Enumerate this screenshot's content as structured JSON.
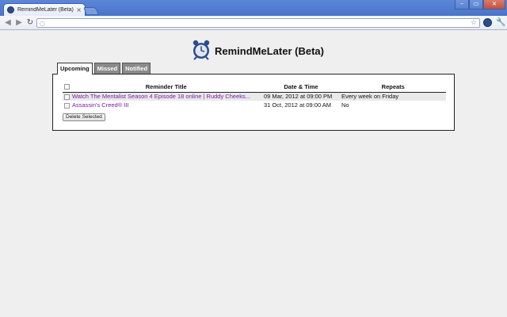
{
  "browser": {
    "tab_title": "RemindMeLater (Beta) - Up",
    "tab_close": "×",
    "window_buttons": [
      "–",
      "▭",
      "×"
    ]
  },
  "app": {
    "title": "RemindMeLater (Beta)"
  },
  "tabs": [
    {
      "label": "Upcoming",
      "active": true
    },
    {
      "label": "Missed",
      "active": false
    },
    {
      "label": "Notified",
      "active": false
    }
  ],
  "table": {
    "headers": [
      "",
      "Reminder Title",
      "Date & Time",
      "Repeats"
    ],
    "rows": [
      {
        "title": "Watch The Mentalist Season 4 Episode 18 online | Ruddy Cheeks...",
        "datetime": "09 Mar, 2012 at 09:00 PM",
        "repeats": "Every week on Friday"
      },
      {
        "title": "Assassin's Creed® III",
        "datetime": "31 Oct, 2012 at 09:00 AM",
        "repeats": "No"
      }
    ]
  },
  "actions": {
    "delete_label": "Delete Selected"
  },
  "icons": {
    "back": "back-arrow-icon",
    "forward": "forward-arrow-icon",
    "reload": "reload-icon",
    "star": "bookmark-star-icon",
    "wrench": "wrench-icon",
    "alarm": "alarm-clock-icon"
  },
  "colors": {
    "chrome_blue": "#4a74c8",
    "link_purple": "#7a1aa6",
    "clock_blue": "#2c4b8c"
  }
}
